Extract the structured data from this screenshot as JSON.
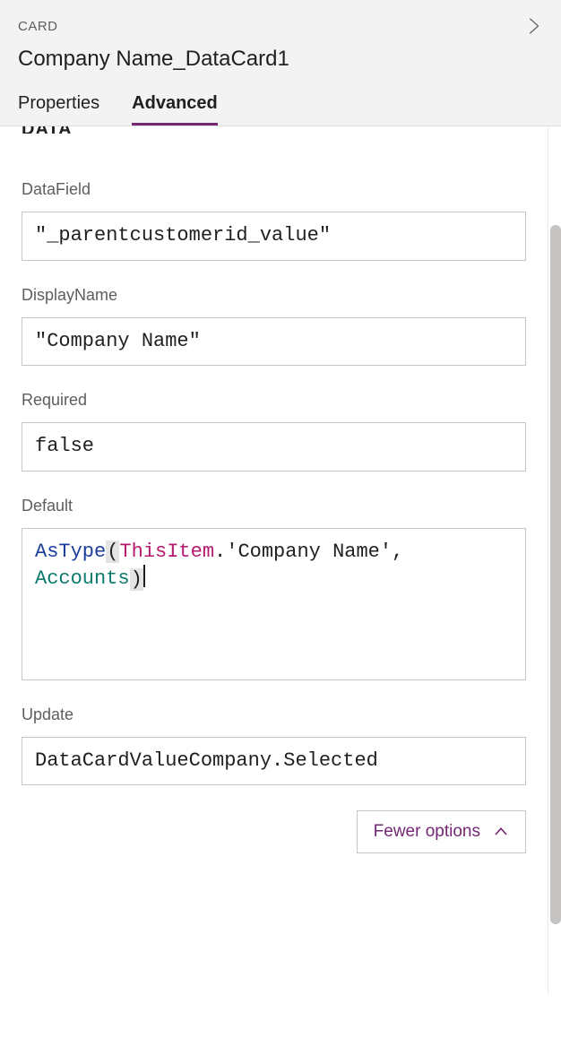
{
  "header": {
    "category": "CARD",
    "title": "Company Name_DataCard1"
  },
  "tabs": {
    "properties": "Properties",
    "advanced": "Advanced"
  },
  "section_cut": "DATA",
  "fields": {
    "datafield": {
      "label": "DataField",
      "value": "\"_parentcustomerid_value\""
    },
    "displayname": {
      "label": "DisplayName",
      "value": "\"Company Name\""
    },
    "required": {
      "label": "Required",
      "value": "false"
    },
    "default": {
      "label": "Default",
      "formula": {
        "func": "AsType",
        "ident": "ThisItem",
        "literal": "'Company Name'",
        "arg2": "Accounts",
        "comma_space": ", "
      }
    },
    "update": {
      "label": "Update",
      "value": "DataCardValueCompany.Selected"
    }
  },
  "fewer_options": "Fewer options"
}
